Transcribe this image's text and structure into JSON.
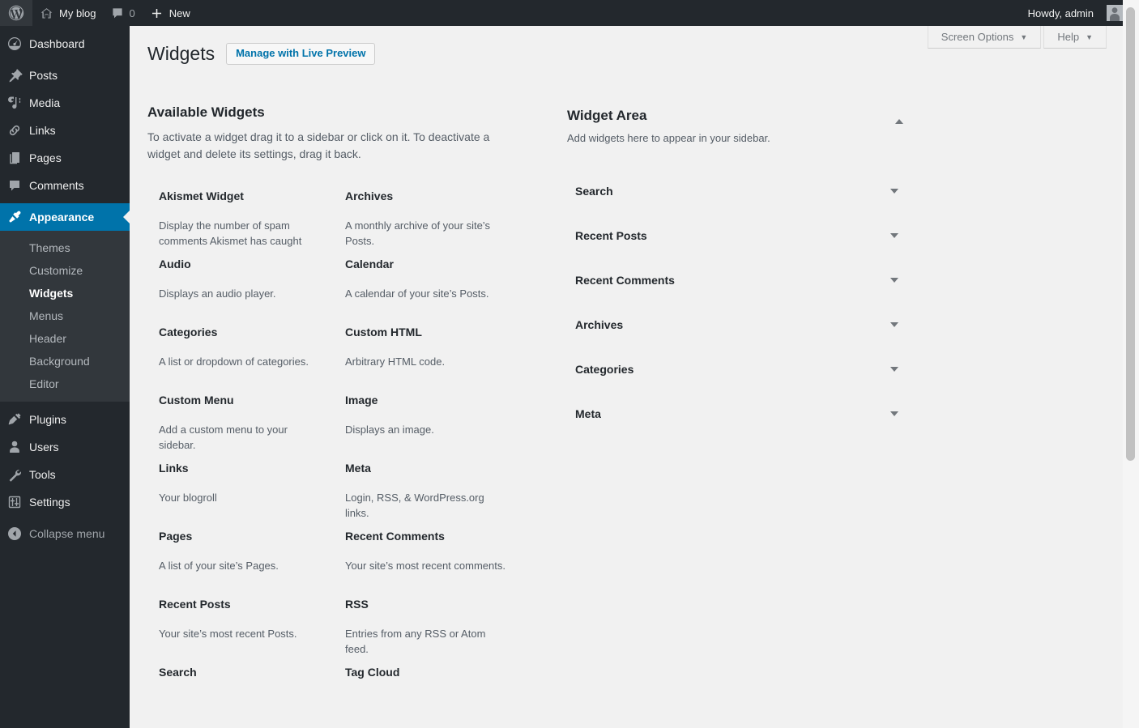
{
  "adminbar": {
    "logo_icon": "wordpress-logo-icon",
    "site_icon": "home-icon",
    "site_name": "My blog",
    "comments_icon": "comment-bubble-icon",
    "comments_count": "0",
    "new_icon": "plus-icon",
    "new_label": "New",
    "howdy": "Howdy, admin",
    "avatar_icon": "user-avatar-icon"
  },
  "sidebar": {
    "items": [
      {
        "label": "Dashboard",
        "icon": "dashboard-icon",
        "current": false,
        "sep_after": true
      },
      {
        "label": "Posts",
        "icon": "pin-icon",
        "current": false,
        "sep_after": false
      },
      {
        "label": "Media",
        "icon": "media-icon",
        "current": false,
        "sep_after": false
      },
      {
        "label": "Links",
        "icon": "link-icon",
        "current": false,
        "sep_after": false
      },
      {
        "label": "Pages",
        "icon": "pages-icon",
        "current": false,
        "sep_after": false
      },
      {
        "label": "Comments",
        "icon": "comment-bubble-icon",
        "current": false,
        "sep_after": true
      },
      {
        "label": "Appearance",
        "icon": "appearance-brush-icon",
        "current": true,
        "sep_after": false
      }
    ],
    "submenu": [
      {
        "label": "Themes",
        "current": false
      },
      {
        "label": "Customize",
        "current": false
      },
      {
        "label": "Widgets",
        "current": true
      },
      {
        "label": "Menus",
        "current": false
      },
      {
        "label": "Header",
        "current": false
      },
      {
        "label": "Background",
        "current": false
      },
      {
        "label": "Editor",
        "current": false
      }
    ],
    "items_lower": [
      {
        "label": "Plugins",
        "icon": "plugin-icon"
      },
      {
        "label": "Users",
        "icon": "user-icon"
      },
      {
        "label": "Tools",
        "icon": "wrench-icon"
      },
      {
        "label": "Settings",
        "icon": "settings-sliders-icon"
      }
    ],
    "collapse": {
      "label": "Collapse menu",
      "icon": "collapse-arrow-icon"
    },
    "accent_color": "#0073aa",
    "bg_color": "#23282d",
    "submenu_bg_color": "#32373c"
  },
  "screen_meta": {
    "screen_options_label": "Screen Options",
    "help_label": "Help",
    "caret_icon": "chevron-down-icon"
  },
  "page": {
    "title": "Widgets",
    "live_preview_button": "Manage with Live Preview"
  },
  "available": {
    "heading": "Available Widgets",
    "description": "To activate a widget drag it to a sidebar or click on it. To deactivate a widget and delete its settings, drag it back.",
    "widgets": [
      {
        "title": "Akismet Widget",
        "desc": "Display the number of spam comments Akismet has caught"
      },
      {
        "title": "Archives",
        "desc": "A monthly archive of your site’s Posts."
      },
      {
        "title": "Audio",
        "desc": "Displays an audio player."
      },
      {
        "title": "Calendar",
        "desc": "A calendar of your site’s Posts."
      },
      {
        "title": "Categories",
        "desc": "A list or dropdown of categories."
      },
      {
        "title": "Custom HTML",
        "desc": "Arbitrary HTML code."
      },
      {
        "title": "Custom Menu",
        "desc": "Add a custom menu to your sidebar."
      },
      {
        "title": "Image",
        "desc": "Displays an image."
      },
      {
        "title": "Links",
        "desc": "Your blogroll"
      },
      {
        "title": "Meta",
        "desc": "Login, RSS, & WordPress.org links."
      },
      {
        "title": "Pages",
        "desc": "A list of your site’s Pages."
      },
      {
        "title": "Recent Comments",
        "desc": "Your site’s most recent comments."
      },
      {
        "title": "Recent Posts",
        "desc": "Your site’s most recent Posts."
      },
      {
        "title": "RSS",
        "desc": "Entries from any RSS or Atom feed."
      },
      {
        "title": "Search",
        "desc": ""
      },
      {
        "title": "Tag Cloud",
        "desc": ""
      }
    ]
  },
  "widget_area": {
    "title": "Widget Area",
    "description": "Add widgets here to appear in your sidebar.",
    "toggle_icon": "chevron-up-icon",
    "row_caret_icon": "chevron-down-icon",
    "widgets": [
      {
        "title": "Search"
      },
      {
        "title": "Recent Posts"
      },
      {
        "title": "Recent Comments"
      },
      {
        "title": "Archives"
      },
      {
        "title": "Categories"
      },
      {
        "title": "Meta"
      }
    ]
  },
  "scrollbar": {
    "name": "page-scrollbar"
  }
}
